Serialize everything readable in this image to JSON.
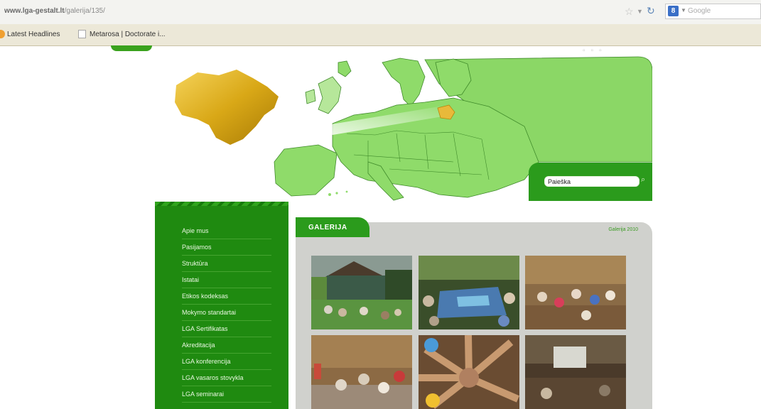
{
  "browser": {
    "url_domain": "www.lga-gestalt.lt",
    "url_path": "/galerija/135/",
    "search_engine_letter": "8",
    "search_placeholder": "Google"
  },
  "bookmarks": {
    "items": [
      "Latest Headlines",
      "Metarosa | Doctorate i..."
    ]
  },
  "search": {
    "value": "Paieška"
  },
  "sidebar": {
    "items": [
      "Apie mus",
      "Pasijamos",
      "Struktūra",
      "Istatai",
      "Etikos kodeksas",
      "Mokymo standartai",
      "LGA Sertifikatas",
      "Akreditacija",
      "LGA konferencija",
      "LGA vasaros stovykla",
      "LGA seminarai"
    ]
  },
  "gallery": {
    "title": "GALERIJA",
    "link": "Galerija 2010",
    "photos": [
      "outdoor-group-house",
      "children-mat-lawn",
      "children-wooden-room",
      "children-on-floor",
      "hands-circle",
      "screening-room"
    ]
  },
  "colors": {
    "brand_green": "#2b9b1c",
    "sidebar_green": "#1f8a10",
    "map_green": "#8fdb6a",
    "lithuania_gold": "#d9a817",
    "gallery_bg": "#d0d1cd"
  }
}
